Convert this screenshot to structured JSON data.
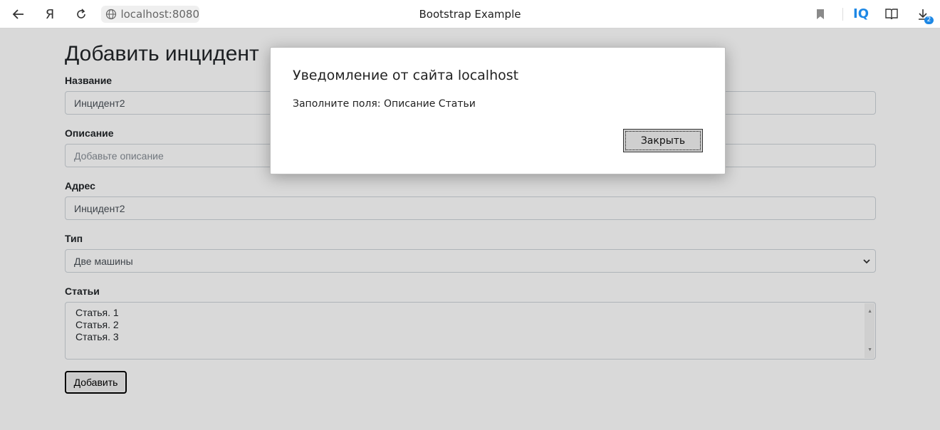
{
  "browser": {
    "url": "localhost:8080",
    "tab_title": "Bootstrap Example",
    "ext_label": "IQ",
    "downloads_count": "2"
  },
  "form": {
    "heading": "Добавить инцидент",
    "name_label": "Название",
    "name_value": "Инцидент2",
    "description_label": "Описание",
    "description_placeholder": "Добавьте описание",
    "address_label": "Адрес",
    "address_value": "Инцидент2",
    "type_label": "Тип",
    "type_value": "Две машины",
    "articles_label": "Статьи",
    "articles": [
      "Статья. 1",
      "Статья. 2",
      "Статья. 3"
    ],
    "submit_label": "Добавить"
  },
  "dialog": {
    "title": "Уведомление от сайта localhost",
    "message": "Заполните поля: Описание Статьи",
    "close_label": "Закрыть"
  }
}
